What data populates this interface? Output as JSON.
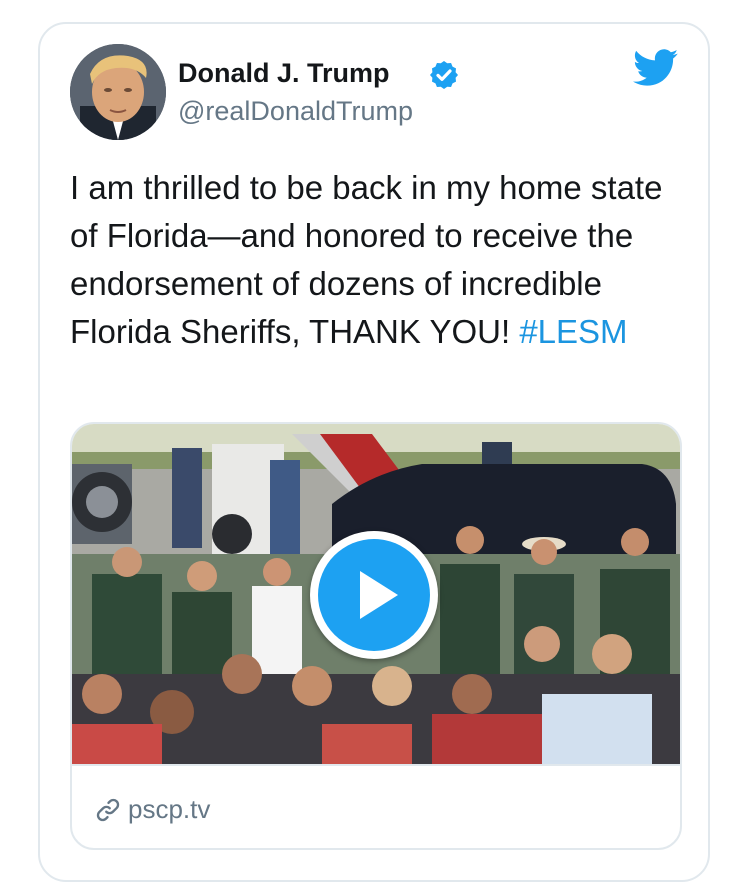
{
  "tweet": {
    "author_name": "Donald J. Trump",
    "author_handle": "@realDonaldTrump",
    "verified": true,
    "text": "I am thrilled to be back in my home state of Florida—and honored to receive the endorsement of dozens of incredible Florida Sheriffs, THANK YOU! ",
    "hashtag": "#LESM"
  },
  "media": {
    "type": "video",
    "link_url": "pscp.tv"
  },
  "icons": {
    "verified": "verified-badge-icon",
    "brand": "twitter-bird-icon",
    "play": "play-icon",
    "link": "link-icon"
  },
  "colors": {
    "accent": "#1da1f2",
    "link": "#1b95e0",
    "secondary_text": "#657786",
    "border": "#e1e8ed"
  }
}
